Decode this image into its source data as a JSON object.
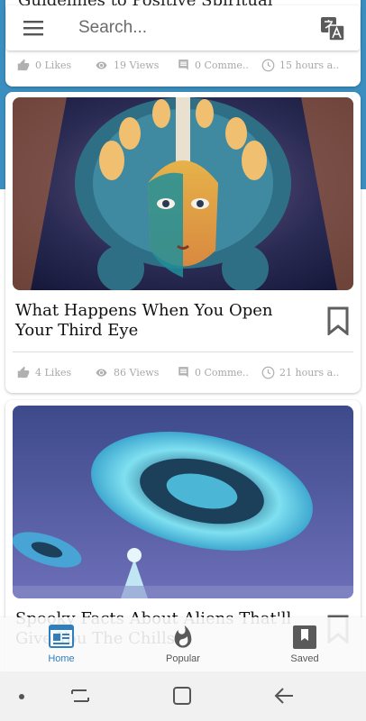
{
  "app": {
    "search_placeholder": "Search...",
    "accent": "#2f7fbf",
    "band_color": "#3b8fc0"
  },
  "top_card": {
    "title": "Guidelines to Positive Spiritual",
    "likes": "0 Likes",
    "views": "19 Views",
    "comments": "0 Comme..",
    "time": "15 hours a.."
  },
  "posts": [
    {
      "title": "What Happens When You Open Your Third Eye",
      "likes": "4 Likes",
      "views": "86 Views",
      "comments": "0 Comme..",
      "time": "21 hours a.."
    },
    {
      "title": "Spooky Facts About Aliens That'll Give You The Chills"
    }
  ],
  "bottom_nav": {
    "items": [
      {
        "label": "Home",
        "icon": "newspaper-icon",
        "active": true
      },
      {
        "label": "Popular",
        "icon": "flame-icon",
        "active": false
      },
      {
        "label": "Saved",
        "icon": "bookmark-icon",
        "active": false
      }
    ]
  },
  "system_nav": {
    "icons": [
      "dot-icon",
      "recents-icon",
      "home-square-icon",
      "back-arrow-icon"
    ]
  }
}
